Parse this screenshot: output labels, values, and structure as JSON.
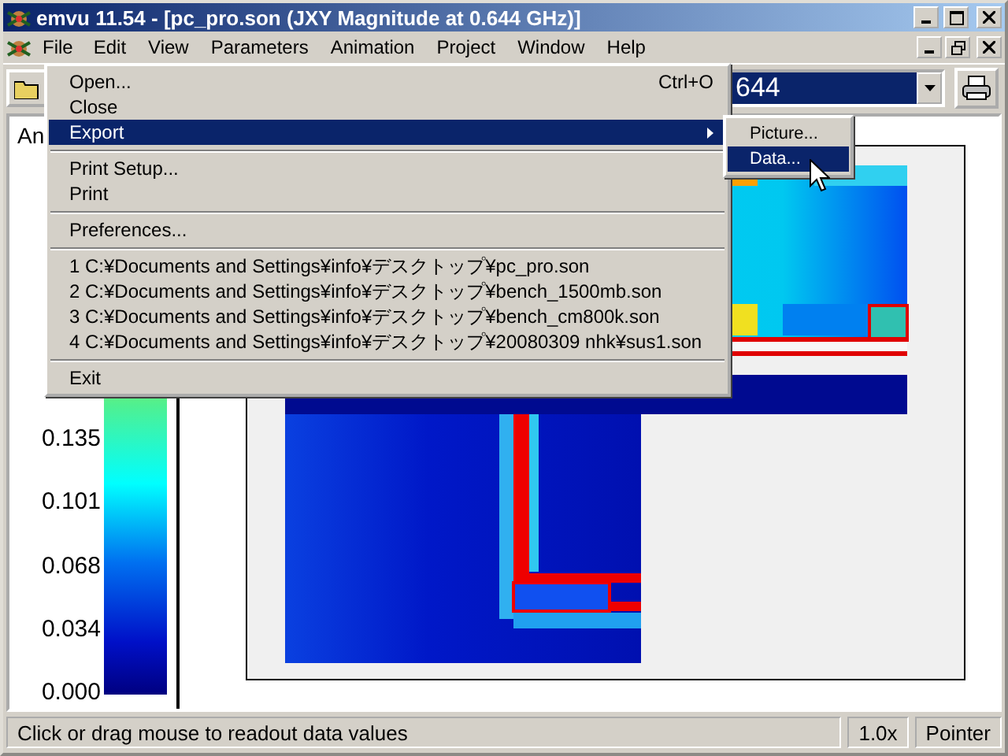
{
  "window": {
    "title": "emvu 11.54 - [pc_pro.son (JXY Magnitude at 0.644 GHz)]"
  },
  "menu_bar": [
    {
      "label": "File",
      "selected": true
    },
    {
      "label": "Edit",
      "selected": false
    },
    {
      "label": "View",
      "selected": false
    },
    {
      "label": "Parameters",
      "selected": false
    },
    {
      "label": "Animation",
      "selected": false
    },
    {
      "label": "Project",
      "selected": false
    },
    {
      "label": "Window",
      "selected": false
    },
    {
      "label": "Help",
      "selected": false
    }
  ],
  "toolbar": {
    "combo_value": "644"
  },
  "file_menu": [
    {
      "kind": "item",
      "label": "Open...",
      "shortcut": "Ctrl+O",
      "highlighted": false
    },
    {
      "kind": "item",
      "label": "Close",
      "highlighted": false
    },
    {
      "kind": "submenu",
      "label": "Export",
      "highlighted": true
    },
    {
      "kind": "separator"
    },
    {
      "kind": "item",
      "label": "Print Setup...",
      "highlighted": false
    },
    {
      "kind": "item",
      "label": "Print",
      "highlighted": false
    },
    {
      "kind": "separator"
    },
    {
      "kind": "item",
      "label": "Preferences...",
      "highlighted": false
    },
    {
      "kind": "separator"
    },
    {
      "kind": "item",
      "label": "1 C:¥Documents and Settings¥info¥デスクトップ¥pc_pro.son",
      "highlighted": false
    },
    {
      "kind": "item",
      "label": "2 C:¥Documents and Settings¥info¥デスクトップ¥bench_1500mb.son",
      "highlighted": false
    },
    {
      "kind": "item",
      "label": "3 C:¥Documents and Settings¥info¥デスクトップ¥bench_cm800k.son",
      "highlighted": false
    },
    {
      "kind": "item",
      "label": "4 C:¥Documents and Settings¥info¥デスクトップ¥20080309 nhk¥sus1.son",
      "highlighted": false
    },
    {
      "kind": "separator"
    },
    {
      "kind": "item",
      "label": "Exit",
      "highlighted": false
    }
  ],
  "export_submenu": [
    {
      "label": "Picture...",
      "highlighted": false
    },
    {
      "label": "Data...",
      "highlighted": true
    }
  ],
  "legend": {
    "title": "An",
    "ticks": [
      "0.135",
      "0.101",
      "0.068",
      "0.034",
      "0.000"
    ]
  },
  "status_bar": {
    "message": "Click or drag mouse to readout data values",
    "zoom": "1.0x",
    "mode": "Pointer"
  }
}
